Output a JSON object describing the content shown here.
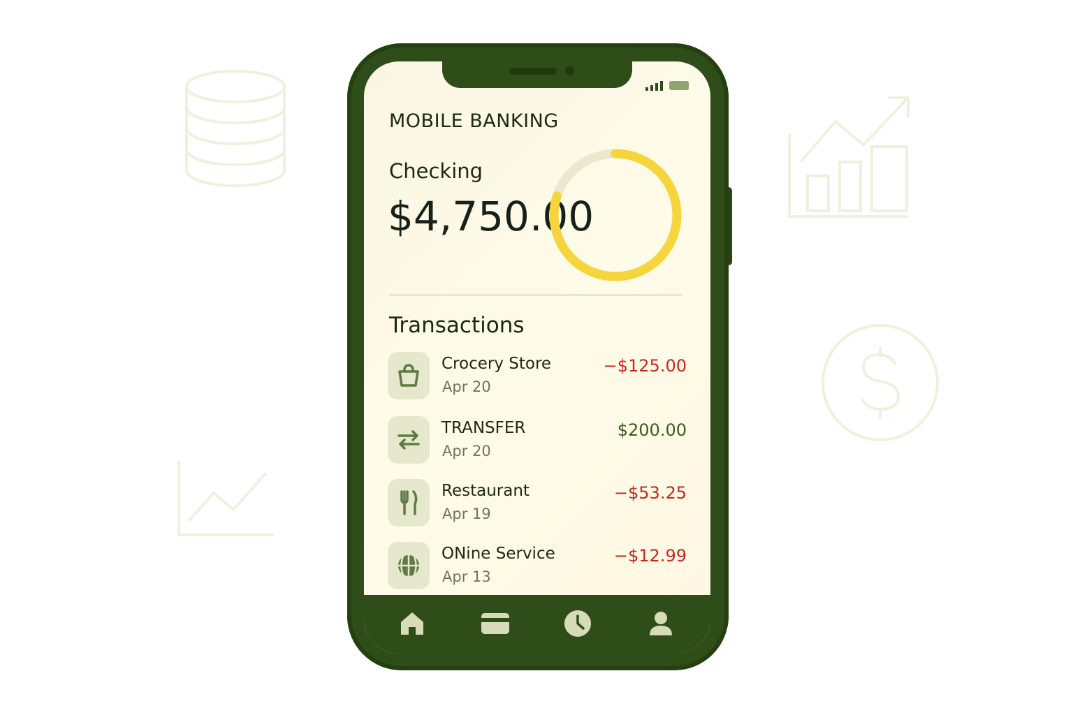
{
  "app": {
    "title": "MOBILE BANKING"
  },
  "account": {
    "label": "Checking",
    "balance": "$4,750.00",
    "ring_fill_fraction": 0.8
  },
  "transactions": {
    "heading": "Transactions",
    "items": [
      {
        "name": "Crocery Store",
        "date": "Apr 20",
        "amount": "−$125.00",
        "amount_color": "#c32a1c",
        "icon": "shopping-bag-icon"
      },
      {
        "name": "TRANSFER",
        "date": "Apr 20",
        "amount": "$200.00",
        "amount_color": "#3b5a22",
        "icon": "transfer-arrows-icon"
      },
      {
        "name": "Restaurant",
        "date": "Apr 19",
        "amount": "−$53.25",
        "amount_color": "#c32a1c",
        "icon": "fork-knife-icon"
      },
      {
        "name": "ONine Service",
        "date": "Apr 13",
        "amount": "−$12.99",
        "amount_color": "#c32a1c",
        "icon": "globe-icon"
      }
    ]
  },
  "nav": {
    "items": [
      "home-icon",
      "card-icon",
      "clock-icon",
      "profile-icon"
    ]
  },
  "colors": {
    "phone_body": "#2f4d19",
    "screen_bg": "#fdf8e6",
    "ring_accent": "#f5d53b",
    "ring_track": "#ece7cf",
    "debit": "#c32a1c",
    "credit": "#3b5a22",
    "icon_tile": "#e6e8cd",
    "icon_stroke": "#5f7a45",
    "nav_icon": "#d7dcb8"
  }
}
